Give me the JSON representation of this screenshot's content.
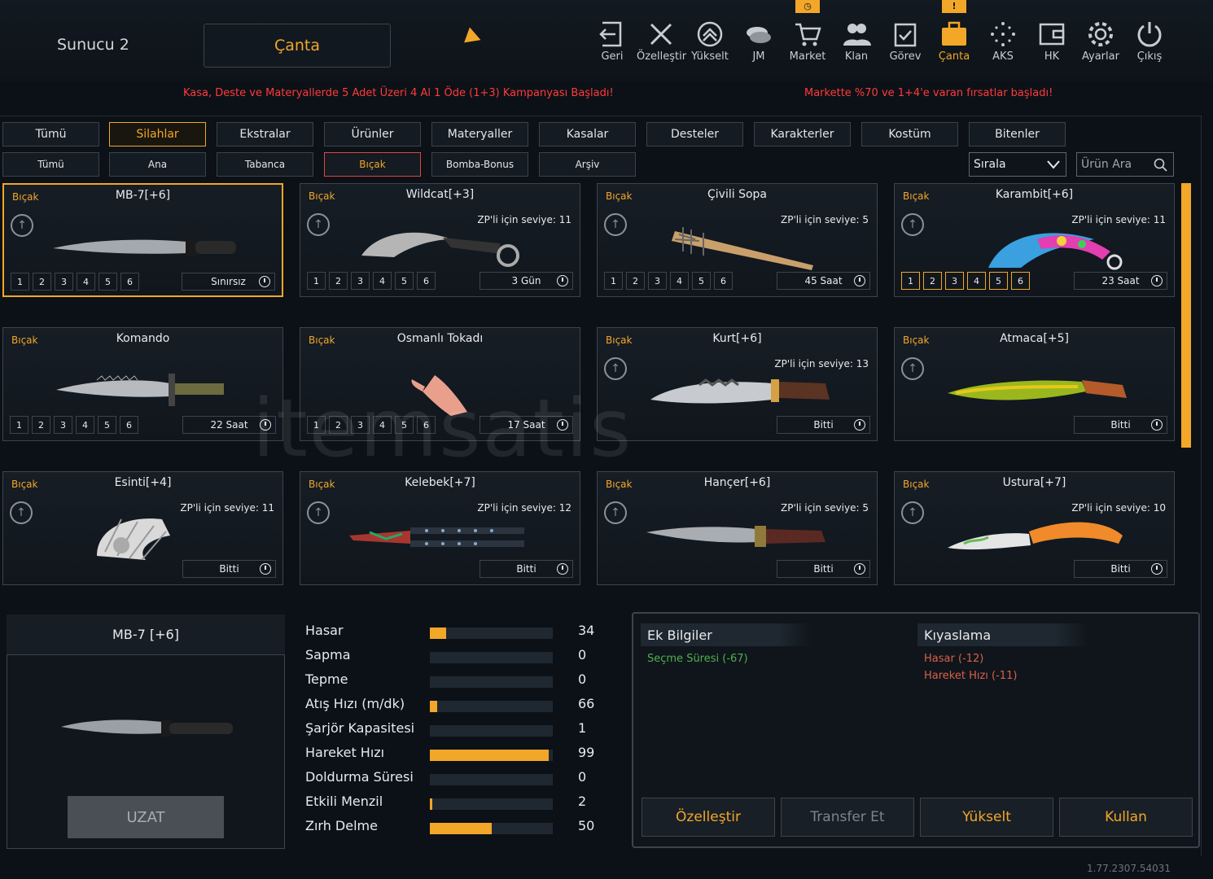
{
  "header": {
    "server": "Sunucu 2",
    "current_section": "Çanta",
    "nav": [
      {
        "label": "Geri",
        "icon": "back-icon"
      },
      {
        "label": "Özelleştir",
        "icon": "tools-icon"
      },
      {
        "label": "Yükselt",
        "icon": "upgrade-icon"
      },
      {
        "label": "JM",
        "icon": "coins-icon"
      },
      {
        "label": "Market",
        "icon": "cart-icon",
        "badge": "clock"
      },
      {
        "label": "Klan",
        "icon": "clan-icon"
      },
      {
        "label": "Görev",
        "icon": "mission-icon"
      },
      {
        "label": "Çanta",
        "icon": "bag-icon",
        "badge": "!",
        "active": true
      },
      {
        "label": "AKS",
        "icon": "dots-icon"
      },
      {
        "label": "HK",
        "icon": "wallet-icon"
      },
      {
        "label": "Ayarlar",
        "icon": "gear-icon"
      },
      {
        "label": "Çıkış",
        "icon": "power-icon"
      }
    ]
  },
  "promos": [
    "Kasa, Deste ve Materyallerde 5 Adet Üzeri 4 Al 1 Öde (1+3) Kampanyası Başladı!",
    "Markette %70 ve 1+4'e varan fırsatlar başladı!"
  ],
  "tabs": [
    "Tümü",
    "Silahlar",
    "Ekstralar",
    "Ürünler",
    "Materyaller",
    "Kasalar",
    "Desteler",
    "Karakterler",
    "Kostüm",
    "Bitenler"
  ],
  "active_tab": "Silahlar",
  "subtabs": [
    "Tümü",
    "Ana",
    "Tabanca",
    "Bıçak",
    "Bomba-Bonus",
    "Arşiv"
  ],
  "active_subtab": "Bıçak",
  "sort_label": "Sırala",
  "search_placeholder": "Ürün Ara",
  "watermark": "itemsatis",
  "items": [
    {
      "category": "Bıçak",
      "name": "MB-7[+6]",
      "level": "",
      "time": "Sınırsız",
      "upgrade": true,
      "nums": true,
      "selected": true,
      "kind": "knife"
    },
    {
      "category": "Bıçak",
      "name": "Wildcat[+3]",
      "level": "ZP'li için seviye: 11",
      "time": "3 Gün",
      "upgrade": true,
      "nums": true,
      "kind": "karambit"
    },
    {
      "category": "Bıçak",
      "name": "Çivili Sopa",
      "level": "ZP'li için seviye: 5",
      "time": "45 Saat",
      "upgrade": true,
      "nums": true,
      "kind": "bat"
    },
    {
      "category": "Bıçak",
      "name": "Karambit[+6]",
      "level": "ZP'li için seviye: 11",
      "time": "23 Saat",
      "upgrade": true,
      "nums": true,
      "gold": true,
      "kind": "karambit2"
    },
    {
      "category": "Bıçak",
      "name": "Komando",
      "level": "",
      "time": "22 Saat",
      "upgrade": false,
      "nums": true,
      "kind": "knife2"
    },
    {
      "category": "Bıçak",
      "name": "Osmanlı Tokadı",
      "level": "",
      "time": "17 Saat",
      "upgrade": false,
      "nums": true,
      "kind": "hand"
    },
    {
      "category": "Bıçak",
      "name": "Kurt[+6]",
      "level": "ZP'li için seviye: 13",
      "time": "Bitti",
      "upgrade": true,
      "nums": false,
      "kind": "knife3"
    },
    {
      "category": "Bıçak",
      "name": "Atmaca[+5]",
      "level": "",
      "time": "Bitti",
      "upgrade": true,
      "nums": false,
      "kind": "kukri"
    },
    {
      "category": "Bıçak",
      "name": "Esinti[+4]",
      "level": "ZP'li için seviye: 11",
      "time": "Bitti",
      "upgrade": true,
      "nums": false,
      "kind": "fan"
    },
    {
      "category": "Bıçak",
      "name": "Kelebek[+7]",
      "level": "ZP'li için seviye: 12",
      "time": "Bitti",
      "upgrade": true,
      "nums": false,
      "kind": "butterfly"
    },
    {
      "category": "Bıçak",
      "name": "Hançer[+6]",
      "level": "ZP'li için seviye: 5",
      "time": "Bitti",
      "upgrade": true,
      "nums": false,
      "kind": "dagger"
    },
    {
      "category": "Bıçak",
      "name": "Ustura[+7]",
      "level": "ZP'li için seviye: 10",
      "time": "Bitti",
      "upgrade": true,
      "nums": false,
      "kind": "razor"
    }
  ],
  "detail": {
    "title": "MB-7 [+6]",
    "extend_button": "UZAT"
  },
  "stats": [
    {
      "label": "Hasar",
      "value": "34",
      "fill": 0.13
    },
    {
      "label": "Sapma",
      "value": "0",
      "fill": 0
    },
    {
      "label": "Tepme",
      "value": "0",
      "fill": 0
    },
    {
      "label": "Atış Hızı (m/dk)",
      "value": "66",
      "fill": 0.06
    },
    {
      "label": "Şarjör Kapasitesi",
      "value": "1",
      "fill": 0
    },
    {
      "label": "Hareket Hızı",
      "value": "99",
      "fill": 0.97
    },
    {
      "label": "Doldurma Süresi",
      "value": "0",
      "fill": 0
    },
    {
      "label": "Etkili Menzil",
      "value": "2",
      "fill": 0.02
    },
    {
      "label": "Zırh Delme",
      "value": "50",
      "fill": 0.5
    }
  ],
  "extra_info": {
    "title": "Ek Bilgiler",
    "lines": [
      "Seçme Süresi (-67)"
    ]
  },
  "compare": {
    "title": "Kıyaslama",
    "lines": [
      "Hasar (-12)",
      "Hareket Hızı (-11)"
    ]
  },
  "actions": [
    "Özelleştir",
    "Transfer Et",
    "Yükselt",
    "Kullan"
  ],
  "version": "1.77.2307.54031",
  "colors": {
    "accent": "#f2a728",
    "promo": "#ff3a3a",
    "positive": "#4fb04f",
    "negative": "#d9604a"
  }
}
